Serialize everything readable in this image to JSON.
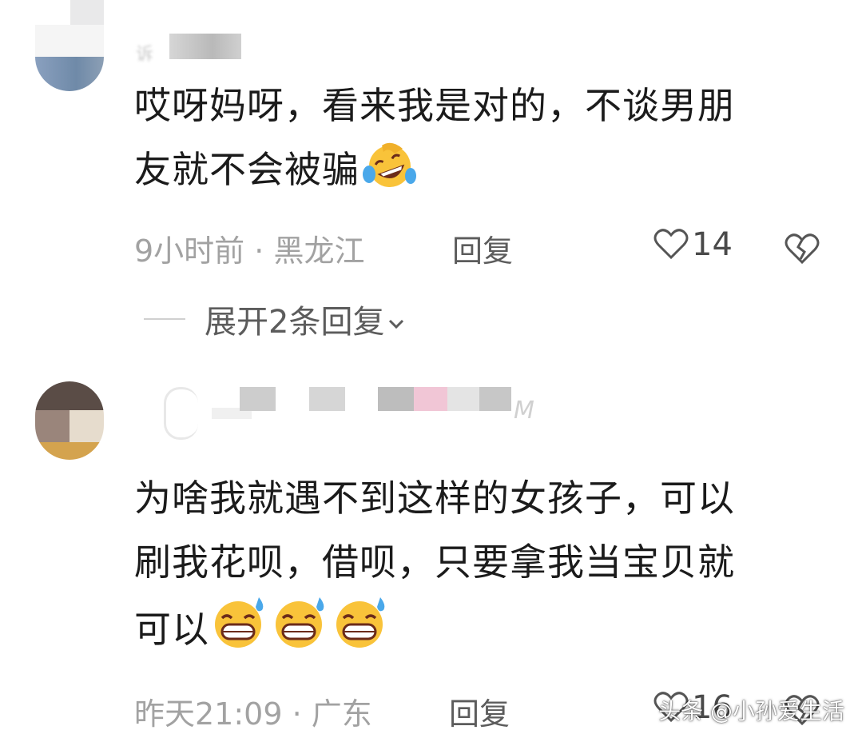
{
  "comments": [
    {
      "text_line1": "哎呀妈呀，看来我是对的，不谈男朋",
      "text_line2": "友就不会被骗",
      "time": "9小时前",
      "separator": " · ",
      "location": "黑龙江",
      "reply_label": "回复",
      "likes": "14",
      "emoji": "rolling-on-floor-laughing"
    },
    {
      "text_line1": "为啥我就遇不到这样的女孩子，可以",
      "text_line2": "刷我花呗，借呗，只要拿我当宝贝就",
      "text_line3": "可以",
      "time": "昨天21:09",
      "separator": " · ",
      "location": "广东",
      "reply_label": "回复",
      "likes": "16",
      "emoji": "grinning-face-with-sweat"
    }
  ],
  "expand_replies": {
    "label": "展开2条回复"
  },
  "watermark": "头条 @小孙爱生活",
  "colors": {
    "text": "#1b1b1b",
    "meta": "#a2a2a2",
    "reply": "#5c5c5c",
    "emoji_yellow": "#f9c33a"
  }
}
